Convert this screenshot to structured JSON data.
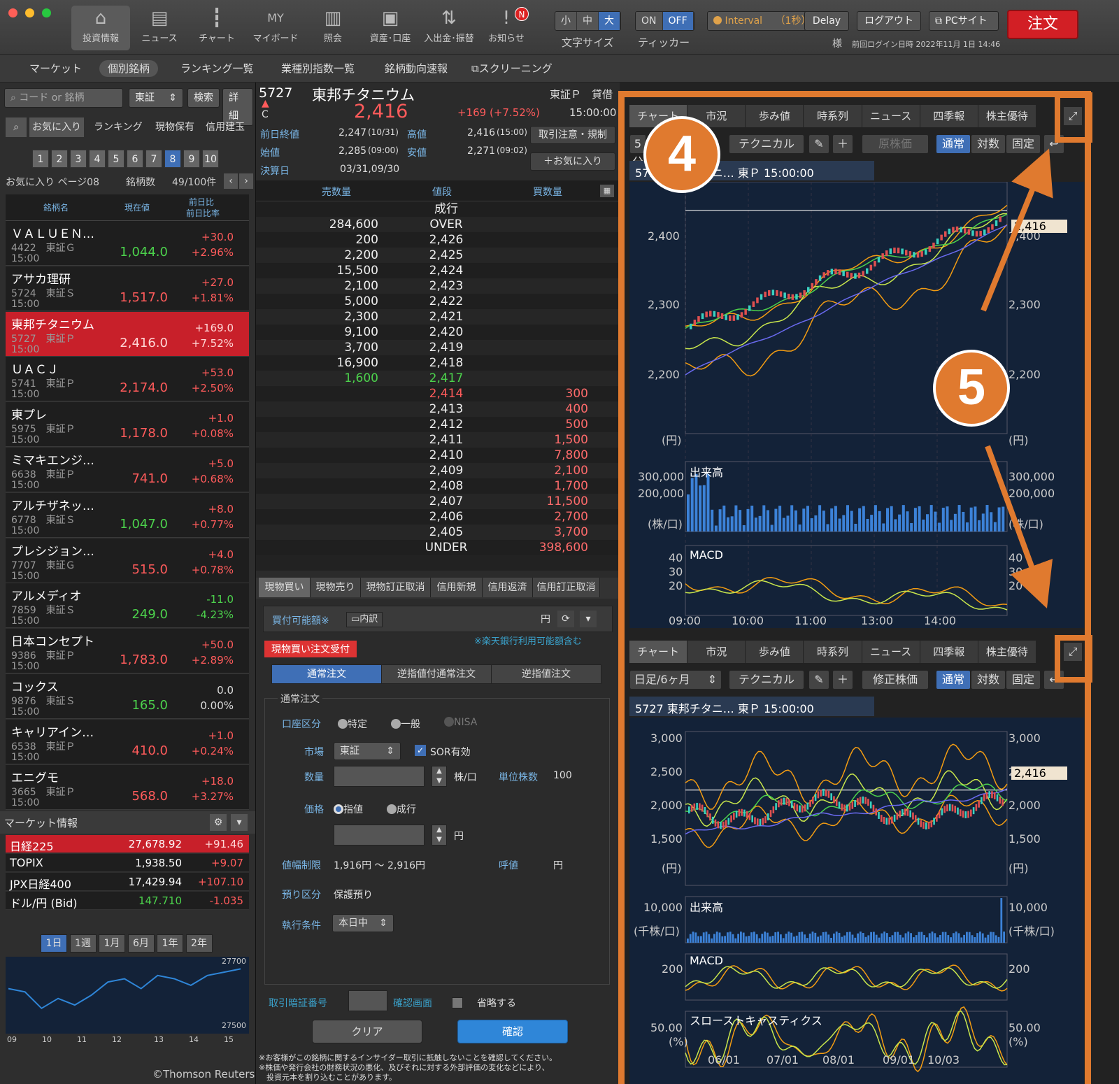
{
  "toolbar": {
    "items": [
      {
        "label": "投資情報",
        "icon": "home-icon"
      },
      {
        "label": "ニュース",
        "icon": "news-icon"
      },
      {
        "label": "チャート",
        "icon": "chart-icon"
      },
      {
        "label": "マイボード",
        "icon": "myboard-icon"
      },
      {
        "label": "照会",
        "icon": "book-icon"
      },
      {
        "label": "資産･口座",
        "icon": "safe-icon"
      },
      {
        "label": "入出金･振替",
        "icon": "transfer-icon"
      },
      {
        "label": "お知らせ",
        "icon": "notice-icon"
      }
    ],
    "notice_badge": "N",
    "size_options": [
      "小",
      "中",
      "大"
    ],
    "size_label": "文字サイズ",
    "ticker_options": [
      "ON",
      "OFF"
    ],
    "ticker_label": "ティッカー",
    "interval_label": "Interval",
    "interval_value": "（1秒）",
    "delay_label": "Delay",
    "logout_label": "ログアウト",
    "pcsite_label": "PCサイト",
    "order_label": "注文",
    "user_suffix": "様",
    "last_login": "前回ログイン日時 2022年11月 1日 14:46"
  },
  "subnav": [
    "マーケット",
    "個別銘柄",
    "ランキング一覧",
    "業種別指数一覧",
    "銘柄動向速報",
    "スクリーニング"
  ],
  "left": {
    "search_placeholder": "コード or 銘柄",
    "market_select": "東証",
    "search_btn": "検索",
    "detail_btn": "詳細",
    "tabs": [
      "お気に入り",
      "ランキング",
      "現物保有",
      "信用建玉"
    ],
    "pages": [
      "1",
      "2",
      "3",
      "4",
      "5",
      "6",
      "7",
      "8",
      "9",
      "10"
    ],
    "page_label": "お気に入り ページ08",
    "count_label": "銘柄数",
    "count_value": "49/100件",
    "col_name": "銘柄名",
    "col_price": "現在値",
    "col_change": "前日比",
    "col_pct": "前日比率",
    "watchlist": [
      {
        "name": "ＶＡＬＵＥＮ…",
        "code": "4422　東証Ｇ",
        "time": "15:00",
        "price": "1,044.0",
        "chg": "+30.0",
        "pct": "+2.96%",
        "dir": "dn"
      },
      {
        "name": "アサカ理研",
        "code": "5724　東証Ｓ",
        "time": "15:00",
        "price": "1,517.0",
        "chg": "+27.0",
        "pct": "+1.81%",
        "dir": "up"
      },
      {
        "name": "東邦チタニウム",
        "code": "5727　東証Ｐ",
        "time": "15:00",
        "price": "2,416.0",
        "chg": "+169.0",
        "pct": "+7.52%",
        "dir": "up"
      },
      {
        "name": "ＵＡＣＪ",
        "code": "5741　東証Ｐ",
        "time": "15:00",
        "price": "2,174.0",
        "chg": "+53.0",
        "pct": "+2.50%",
        "dir": "up"
      },
      {
        "name": "東プレ",
        "code": "5975　東証Ｐ",
        "time": "15:00",
        "price": "1,178.0",
        "chg": "+1.0",
        "pct": "+0.08%",
        "dir": "up"
      },
      {
        "name": "ミマキエンジ…",
        "code": "6638　東証Ｐ",
        "time": "15:00",
        "price": "741.0",
        "chg": "+5.0",
        "pct": "+0.68%",
        "dir": "up"
      },
      {
        "name": "アルチザネッ…",
        "code": "6778　東証Ｓ",
        "time": "15:00",
        "price": "1,047.0",
        "chg": "+8.0",
        "pct": "+0.77%",
        "dir": "dn"
      },
      {
        "name": "プレシジョン…",
        "code": "7707　東証Ｇ",
        "time": "15:00",
        "price": "515.0",
        "chg": "+4.0",
        "pct": "+0.78%",
        "dir": "up"
      },
      {
        "name": "アルメディオ",
        "code": "7859　東証Ｓ",
        "time": "15:00",
        "price": "249.0",
        "chg": "-11.0",
        "pct": "-4.23%",
        "dir": "dn"
      },
      {
        "name": "日本コンセプト",
        "code": "9386　東証Ｐ",
        "time": "15:00",
        "price": "1,783.0",
        "chg": "+50.0",
        "pct": "+2.89%",
        "dir": "up"
      },
      {
        "name": "コックス",
        "code": "9876　東証Ｓ",
        "time": "15:00",
        "price": "165.0",
        "chg": "0.0",
        "pct": "0.00%",
        "dir": "dn"
      },
      {
        "name": "キャリアイン…",
        "code": "6538　東証Ｐ",
        "time": "15:00",
        "price": "410.0",
        "chg": "+1.0",
        "pct": "+0.24%",
        "dir": "up"
      },
      {
        "name": "エニグモ",
        "code": "3665　東証Ｐ",
        "time": "15:00",
        "price": "568.0",
        "chg": "+18.0",
        "pct": "+3.27%",
        "dir": "up"
      }
    ],
    "market_title": "マーケット情報",
    "market": [
      {
        "name": "日経225",
        "value": "27,678.92",
        "chg": "+91.46"
      },
      {
        "name": "TOPIX",
        "value": "1,938.50",
        "chg": "+9.07"
      },
      {
        "name": "JPX日経400",
        "value": "17,429.94",
        "chg": "+107.10"
      },
      {
        "name": "ドル/円 (Bid)",
        "value": "147.710",
        "chg": "-1.035"
      }
    ],
    "ranges": [
      "1日",
      "1週",
      "1月",
      "6月",
      "1年",
      "2年"
    ],
    "mini_ymax": "27700",
    "mini_ymin": "27500",
    "mini_x": [
      "09",
      "10",
      "11",
      "12",
      "13",
      "14",
      "15"
    ],
    "mini_values": [
      27620,
      27610,
      27560,
      27590,
      27570,
      27600,
      27640,
      27650,
      27620,
      27660,
      27650,
      27630,
      27660,
      27670,
      27680
    ],
    "copyright": "©Thomson Reuters"
  },
  "quote": {
    "code": "5727",
    "name": "東邦チタニウム",
    "market": "東証Ｐ",
    "lending": "貸借",
    "flag": "C",
    "price": "2,416",
    "change": "+169 (+7.52%)",
    "time": "15:00:00",
    "prev_label": "前日終値",
    "prev_value": "2,247",
    "prev_date": "(10/31)",
    "high_label": "高値",
    "high_value": "2,416",
    "high_time": "(15:00)",
    "open_label": "始値",
    "open_value": "2,285",
    "open_time": "(09:00)",
    "low_label": "安値",
    "low_value": "2,271",
    "low_time": "(09:02)",
    "settle_label": "決算日",
    "settle_value": "03/31,09/30",
    "caution_btn": "取引注意・規制",
    "fav_btn": "＋お気に入り"
  },
  "orderbook": {
    "col_sell": "売数量",
    "col_price": "値段",
    "col_buy": "買数量",
    "rows": [
      {
        "s": "",
        "p": "成行",
        "b": ""
      },
      {
        "s": "284,600",
        "p": "OVER",
        "b": ""
      },
      {
        "s": "200",
        "p": "2,426",
        "b": ""
      },
      {
        "s": "2,200",
        "p": "2,425",
        "b": ""
      },
      {
        "s": "15,500",
        "p": "2,424",
        "b": ""
      },
      {
        "s": "2,100",
        "p": "2,423",
        "b": ""
      },
      {
        "s": "5,000",
        "p": "2,422",
        "b": ""
      },
      {
        "s": "2,300",
        "p": "2,421",
        "b": ""
      },
      {
        "s": "9,100",
        "p": "2,420",
        "b": ""
      },
      {
        "s": "3,700",
        "p": "2,419",
        "b": ""
      },
      {
        "s": "16,900",
        "p": "2,418",
        "b": ""
      },
      {
        "s": "1,600",
        "p": "2,417",
        "b": "",
        "hl": "g"
      },
      {
        "s": "",
        "p": "2,414",
        "b": "300",
        "hl": "r"
      },
      {
        "s": "",
        "p": "2,413",
        "b": "400"
      },
      {
        "s": "",
        "p": "2,412",
        "b": "500"
      },
      {
        "s": "",
        "p": "2,411",
        "b": "1,500"
      },
      {
        "s": "",
        "p": "2,410",
        "b": "7,800"
      },
      {
        "s": "",
        "p": "2,409",
        "b": "2,100"
      },
      {
        "s": "",
        "p": "2,408",
        "b": "1,700"
      },
      {
        "s": "",
        "p": "2,407",
        "b": "11,500"
      },
      {
        "s": "",
        "p": "2,406",
        "b": "2,700"
      },
      {
        "s": "",
        "p": "2,405",
        "b": "3,700"
      },
      {
        "s": "",
        "p": "UNDER",
        "b": "398,600"
      }
    ]
  },
  "order": {
    "tabs": [
      "現物買い",
      "現物売り",
      "現物訂正取消",
      "信用新規",
      "信用返済",
      "信用訂正取消"
    ],
    "buying_power_label": "買付可能額※",
    "detail_btn": "内訳",
    "yen": "円",
    "rakuten_note": "※楽天銀行利用可能額含む",
    "accept_badge": "現物買い注文受付",
    "order_types": [
      "通常注文",
      "逆指値付通常注文",
      "逆指値注文"
    ],
    "section_title": "通常注文",
    "account_label": "口座区分",
    "account_opts": [
      "特定",
      "一般",
      "NISA"
    ],
    "market_label": "市場",
    "market_value": "東証",
    "sor_label": "SOR有効",
    "qty_label": "数量",
    "qty_unit": "株/口",
    "unit_label": "単位株数",
    "unit_value": "100",
    "price_label": "価格",
    "price_opts": [
      "指値",
      "成行"
    ],
    "price_unit": "円",
    "limit_label": "値幅制限",
    "limit_value": "1,916円 〜 2,916円",
    "tick_label": "呼値",
    "tick_unit": "円",
    "deposit_label": "預り区分",
    "deposit_value": "保護預り",
    "exec_label": "執行条件",
    "exec_value": "本日中",
    "pin_label": "取引暗証番号",
    "confirm_label": "確認画面",
    "skip_label": "省略する",
    "clear_btn": "クリア",
    "confirm_btn": "確認",
    "note1": "※お客様がこの銘柄に関するインサイダー取引に抵触しないことを確認してください。",
    "note2": "※株価や発行会社の財務状況の悪化、及びそれに対する外部評価の変化などにより、",
    "note3": "　投資元本を割り込むことがあります。"
  },
  "chart_tabs": [
    "チャート",
    "市況",
    "歩み値",
    "時系列",
    "ニュース",
    "四季報",
    "株主優待"
  ],
  "chart1": {
    "period": "5分",
    "technical": "テクニカル",
    "price_type": "原株価",
    "scale_opts": [
      "通常",
      "対数",
      "固定"
    ],
    "title": "5727 東邦チタニ… 東Ｐ 15:00:00",
    "y_ticks": [
      "2,400",
      "2,300",
      "2,200"
    ],
    "y_unit": "(円)",
    "last_price": "2,416",
    "volume_label": "出来高",
    "vol_ticks": [
      "300,000",
      "200,000"
    ],
    "vol_unit": "(株/口)",
    "macd_label": "MACD",
    "macd_ticks": [
      "40",
      "30",
      "20"
    ],
    "x_ticks": [
      "09:00",
      "10:00",
      "11:00",
      "13:00",
      "14:00"
    ]
  },
  "chart2": {
    "period": "日足/6ヶ月",
    "technical": "テクニカル",
    "price_type": "修正株価",
    "scale_opts": [
      "通常",
      "対数",
      "固定"
    ],
    "title": "5727 東邦チタニ… 東Ｐ 15:00:00",
    "y_ticks": [
      "3,000",
      "2,500",
      "2,000",
      "1,500"
    ],
    "y_unit": "(円)",
    "last_price": "2,416",
    "volume_label": "出来高",
    "vol_ticks": [
      "10,000"
    ],
    "vol_unit": "(千株/口)",
    "macd_label": "MACD",
    "macd_ticks": [
      "200"
    ],
    "stoch_label": "スローストキャスティクス",
    "stoch_ticks": [
      "50.00"
    ],
    "stoch_unit": "(%)",
    "x_ticks": [
      "06/01",
      "07/01",
      "08/01",
      "09/01",
      "10/03"
    ]
  },
  "annotations": [
    "4",
    "5"
  ],
  "colors": {
    "accent": "#e07a2f",
    "up": "#ff5b5b",
    "down": "#4cd24c",
    "select": "#3f6fb6"
  }
}
